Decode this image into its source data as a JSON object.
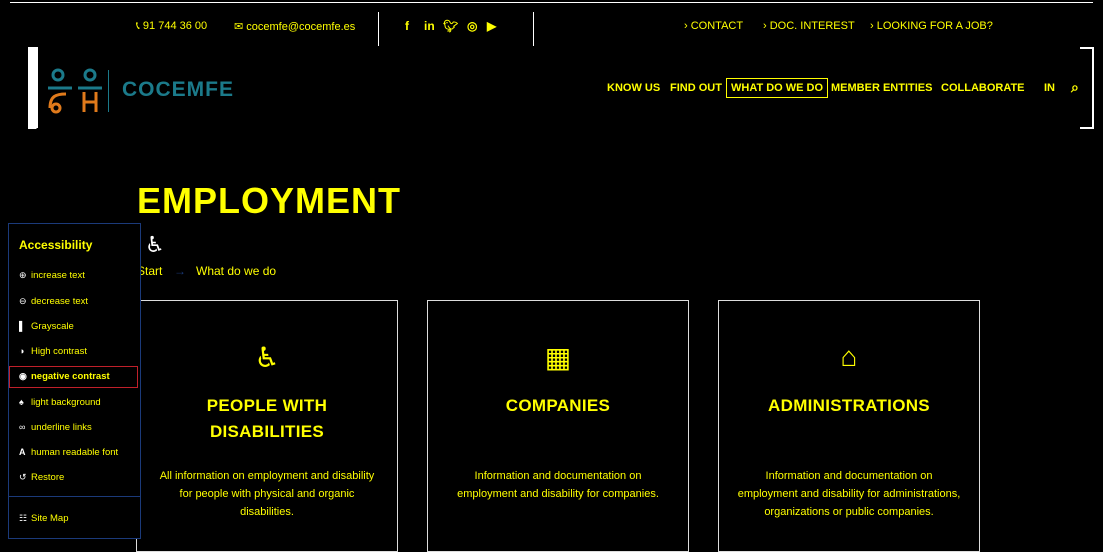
{
  "topbar": {
    "phone": "91 744 36 00",
    "email": "cocemfe@cocemfe.es",
    "social_icons": [
      "facebook-icon",
      "linkedin-icon",
      "twitter-icon",
      "instagram-icon",
      "youtube-icon"
    ],
    "links": [
      "› CONTACT",
      "› DOC. INTEREST",
      "› LOOKING FOR A JOB?"
    ]
  },
  "header": {
    "logo_text": "COCEMFE",
    "nav": [
      "KNOW US",
      "FIND OUT",
      "WHAT DO WE DO",
      "MEMBER ENTITIES",
      "COLLABORATE",
      "IN"
    ]
  },
  "page": {
    "title": "EMPLOYMENT",
    "breadcrumb": [
      "Start",
      "→",
      "What do we do"
    ]
  },
  "cards": [
    {
      "icon": "accessible-person-icon",
      "title_line1": "PEOPLE WITH",
      "title_line2": "DISABILITIES",
      "text": "All information on employment and disability for people with physical and organic disabilities."
    },
    {
      "icon": "building-icon",
      "title_line1": "COMPANIES",
      "title_line2": "",
      "text": "Information and documentation on employment and disability for companies."
    },
    {
      "icon": "government-building-icon",
      "title_line1": "ADMINISTRATIONS",
      "title_line2": "",
      "text": "Information and documentation on employment and disability for administrations, organizations or public companies."
    }
  ],
  "accessibility": {
    "title": "Accessibility",
    "items": [
      "increase text",
      "decrease text",
      "Grayscale",
      "High contrast",
      "negative contrast",
      "light background",
      "underline links",
      "human readable font",
      "Restore"
    ],
    "site_map": "Site Map"
  },
  "colors": {
    "accent": "#ffff00",
    "background": "#000000",
    "logo": "#1b7a8a"
  }
}
